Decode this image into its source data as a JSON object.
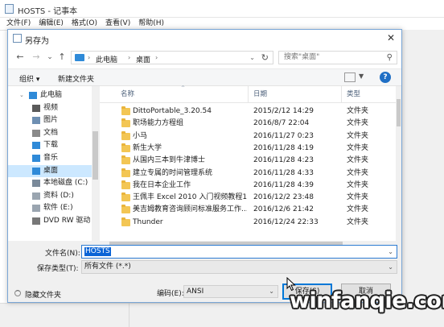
{
  "notepad": {
    "title": "HOSTS - 记事本",
    "menu": [
      "文件(F)",
      "编辑(E)",
      "格式(O)",
      "查看(V)",
      "帮助(H)"
    ]
  },
  "dialog": {
    "title": "另存为",
    "close_glyph": "✕",
    "nav": {
      "back": "←",
      "forward": "→",
      "recent": "⌄",
      "up": "↑"
    },
    "breadcrumb": [
      "此电脑",
      "桌面"
    ],
    "search_placeholder": "搜索\"桌面\"",
    "toolbar": {
      "organize": "组织 ▾",
      "new_folder": "新建文件夹",
      "help": "?"
    },
    "nav_pane": [
      {
        "label": "此电脑",
        "icon": "computer-icon",
        "color": "#2f8ad8",
        "level": 0,
        "expand": "⌄"
      },
      {
        "label": "视频",
        "icon": "video-icon",
        "color": "#5a5a5a",
        "level": 1
      },
      {
        "label": "图片",
        "icon": "picture-icon",
        "color": "#6e8fb2",
        "level": 1
      },
      {
        "label": "文档",
        "icon": "document-icon",
        "color": "#8a8a8a",
        "level": 1
      },
      {
        "label": "下载",
        "icon": "download-icon",
        "color": "#2f8ad8",
        "level": 1
      },
      {
        "label": "音乐",
        "icon": "music-icon",
        "color": "#2f8ad8",
        "level": 1
      },
      {
        "label": "桌面",
        "icon": "desktop-icon",
        "color": "#2f8ad8",
        "level": 1,
        "selected": true
      },
      {
        "label": "本地磁盘 (C:)",
        "icon": "drive-icon",
        "color": "#7a8a9a",
        "level": 1
      },
      {
        "label": "资料 (D:)",
        "icon": "drive-icon",
        "color": "#9aa5b0",
        "level": 1
      },
      {
        "label": "软件 (E:)",
        "icon": "drive-icon",
        "color": "#9aa5b0",
        "level": 1
      },
      {
        "label": "DVD RW 驱动",
        "icon": "dvd-icon",
        "color": "#777777",
        "level": 1
      }
    ],
    "columns": {
      "name": "名称",
      "date": "日期",
      "type": "类型"
    },
    "files": [
      {
        "name": "DittoPortable_3.20.54",
        "date": "2015/2/12 14:29",
        "type": "文件夹"
      },
      {
        "name": "职场能力方程组",
        "date": "2016/8/7 22:04",
        "type": "文件夹"
      },
      {
        "name": "小马",
        "date": "2016/11/27 0:23",
        "type": "文件夹"
      },
      {
        "name": "新生大学",
        "date": "2016/11/28 4:19",
        "type": "文件夹"
      },
      {
        "name": "从国内三本到牛津博士",
        "date": "2016/11/28 4:23",
        "type": "文件夹"
      },
      {
        "name": "建立专属的时间管理系统",
        "date": "2016/11/28 4:33",
        "type": "文件夹"
      },
      {
        "name": "我在日本企业工作",
        "date": "2016/11/28 4:39",
        "type": "文件夹"
      },
      {
        "name": "王佩丰 Excel 2010 入门视频教程1...",
        "date": "2016/12/2 23:48",
        "type": "文件夹"
      },
      {
        "name": "美吉姆教育咨询顾问标准服务工作...",
        "date": "2016/12/6 21:42",
        "type": "文件夹"
      },
      {
        "name": "Thunder",
        "date": "2016/12/24 22:33",
        "type": "文件夹"
      }
    ],
    "filename_label": "文件名(N):",
    "filename_value": "HOSTS",
    "filetype_label": "保存类型(T):",
    "filetype_value": "所有文件  (*.*)",
    "hide_folders": "隐藏文件夹",
    "encoding_label": "编码(E):",
    "encoding_value": "ANSI",
    "save_button": "保存(S)",
    "cancel_button": "取消"
  },
  "watermark": "winfanqie.com"
}
